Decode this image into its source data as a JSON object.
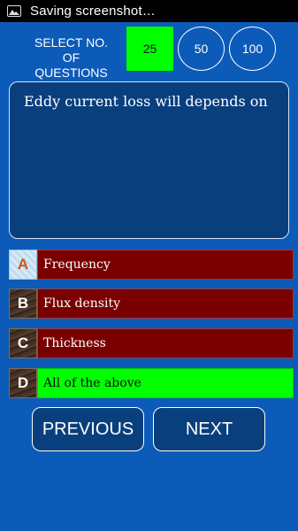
{
  "status_bar": {
    "text": "Saving screenshot…",
    "icon": "image-icon"
  },
  "select": {
    "label": "SELECT NO. OF QUESTIONS",
    "options": [
      "25",
      "50",
      "100"
    ],
    "selected": "25"
  },
  "question": {
    "text": "Eddy current loss will depends on"
  },
  "options": [
    {
      "letter": "A",
      "text": "Frequency"
    },
    {
      "letter": "B",
      "text": "Flux density"
    },
    {
      "letter": "C",
      "text": "Thickness"
    },
    {
      "letter": "D",
      "text": "All of the above",
      "selected": true
    }
  ],
  "nav": {
    "previous": "PREVIOUS",
    "next": "NEXT"
  },
  "colors": {
    "background": "#0d5bb8",
    "selected": "#00ff00",
    "option": "#7a0000"
  }
}
